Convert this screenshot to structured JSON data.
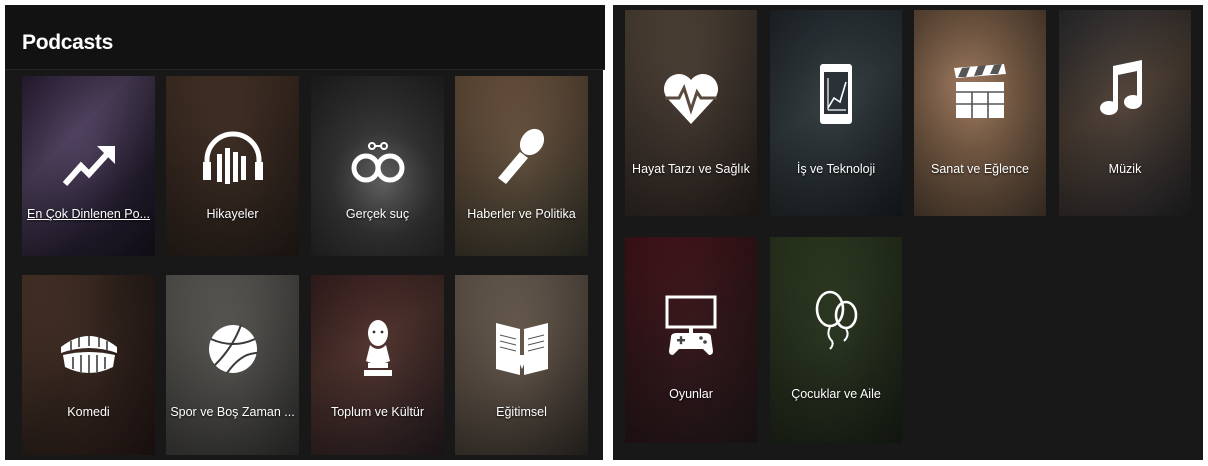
{
  "header": {
    "title": "Podcasts"
  },
  "left_tiles": [
    {
      "label": "En Çok Dinlenen Po...",
      "icon": "trending-up-icon",
      "bg": "linear-gradient(135deg,#3a2b4a 0%,#5c4c6e 35%,#2a2236 70%,#1c1626 100%)"
    },
    {
      "label": "Hikayeler",
      "icon": "headphones-icon",
      "bg": "linear-gradient(160deg,#5a4232 0%,#3e2e25 45%,#2c221d 100%)"
    },
    {
      "label": "Gerçek suç",
      "icon": "handcuffs-icon",
      "bg": "radial-gradient(circle at 55% 60%,#6b6b6b 0%,#3d3d3d 40%,#2a2a2a 100%)"
    },
    {
      "label": "Haberler ve Politika",
      "icon": "microphone-icon",
      "bg": "linear-gradient(160deg,#8a6a4e 0%,#6b5642 40%,#3b3a2e 100%)"
    },
    {
      "label": "Komedi",
      "icon": "teeth-icon",
      "bg": "linear-gradient(120deg,#6a4a3a 0%,#3a2a22 45%,#2a1a18 100%)"
    },
    {
      "label": "Spor ve Boş Zaman ...",
      "icon": "basketball-icon",
      "bg": "linear-gradient(150deg,#7a7670 0%,#5a5854 45%,#3a3a38 100%)"
    },
    {
      "label": "Toplum ve Kültür",
      "icon": "bust-icon",
      "bg": "linear-gradient(150deg,#4a2a2a 0%,#5a3a34 40%,#2e2226 100%)"
    },
    {
      "label": "Eğitimsel",
      "icon": "book-icon",
      "bg": "linear-gradient(150deg,#8a7a6a 0%,#6a5c50 45%,#3a342e 100%)"
    }
  ],
  "right_tiles": [
    {
      "label": "Hayat Tarzı ve Sağlık",
      "icon": "heart-pulse-icon",
      "bg": "linear-gradient(150deg,#6a5a48 0%,#4a3e36 45%,#2e2622 100%)"
    },
    {
      "label": "İş ve Teknoloji",
      "icon": "phone-chart-icon",
      "bg": "linear-gradient(150deg,#2a3238 0%,#3a4448 45%,#1e2428 100%)"
    },
    {
      "label": "Sanat ve Eğlence",
      "icon": "clapperboard-icon",
      "bg": "radial-gradient(circle at 30% 35%,#b0876a 0%,#8a6a50 40%,#5a4838 100%)"
    },
    {
      "label": "Müzik",
      "icon": "music-note-icon",
      "bg": "linear-gradient(150deg,#3a3a3e 0%,#5a4a3e 45%,#2a2a2e 100%)"
    },
    {
      "label": "Oyunlar",
      "icon": "game-console-icon",
      "bg": "linear-gradient(150deg,#5a1a22 0%,#3a1a1e 45%,#2a1c1e 100%)"
    },
    {
      "label": "Çocuklar ve Aile",
      "icon": "balloon-icon",
      "bg": "linear-gradient(150deg,#3a4a2a 0%,#2e3a24 45%,#1e261a 100%)"
    }
  ]
}
